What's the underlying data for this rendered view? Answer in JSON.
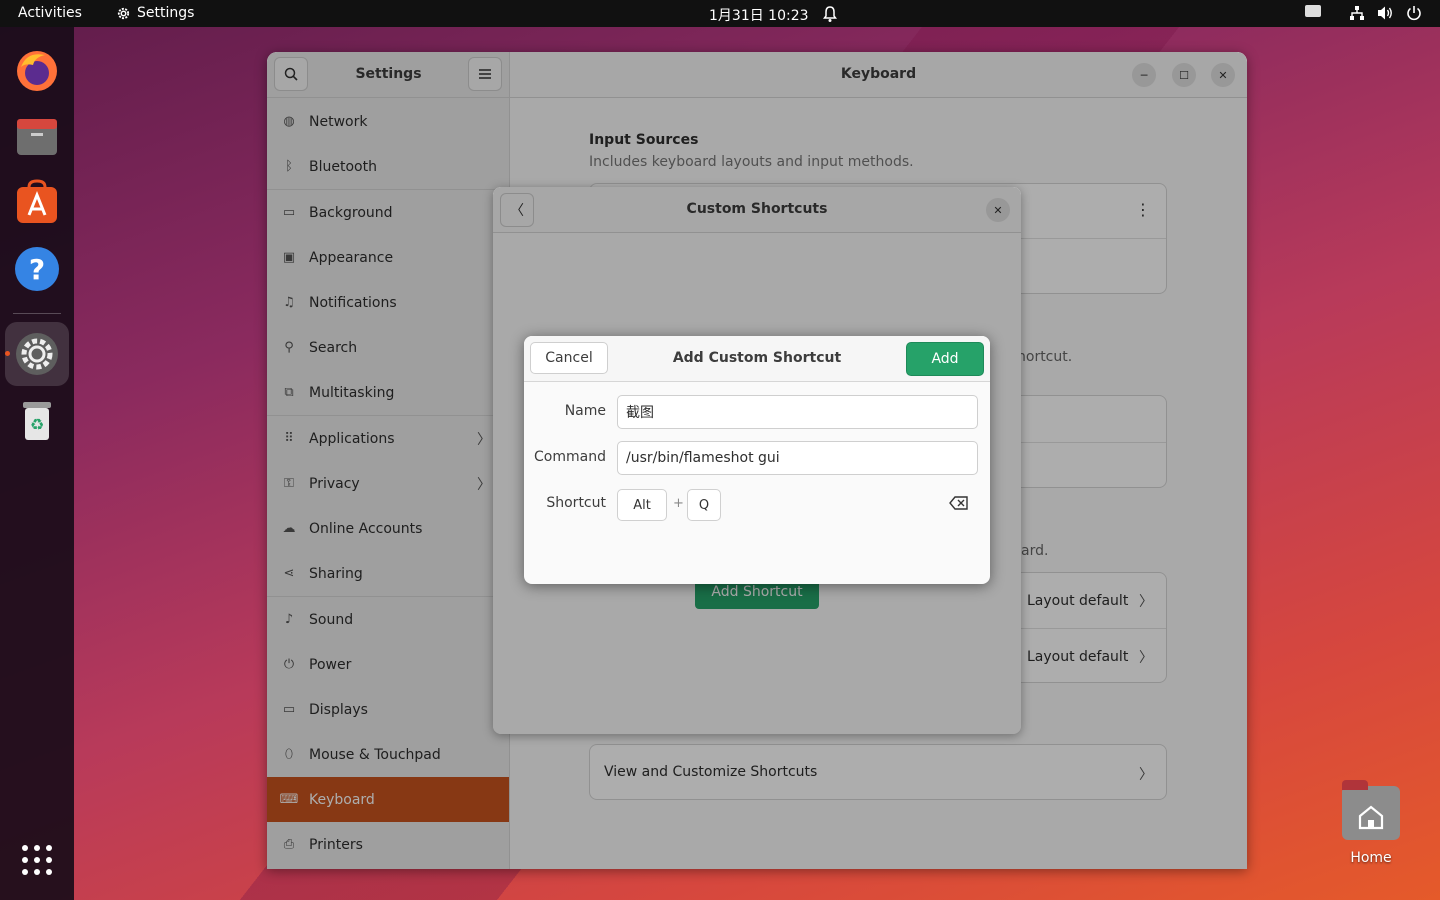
{
  "topbar": {
    "activities": "Activities",
    "app_name": "Settings",
    "clock": "1月31日  10:23"
  },
  "dock": {
    "items": [
      {
        "name": "firefox-icon"
      },
      {
        "name": "files-icon"
      },
      {
        "name": "app-center-icon"
      },
      {
        "name": "help-icon"
      },
      {
        "name": "settings-icon",
        "active": true
      },
      {
        "name": "trash-icon"
      }
    ]
  },
  "desktop": {
    "home_label": "Home"
  },
  "settings": {
    "sidebar_title": "Settings",
    "content_title": "Keyboard",
    "sidebar_items": [
      {
        "label": "Network",
        "icon": "network-icon"
      },
      {
        "label": "Bluetooth",
        "icon": "bluetooth-icon"
      },
      {
        "label": "Background",
        "icon": "background-icon"
      },
      {
        "label": "Appearance",
        "icon": "appearance-icon"
      },
      {
        "label": "Notifications",
        "icon": "bell-icon"
      },
      {
        "label": "Search",
        "icon": "search-icon"
      },
      {
        "label": "Multitasking",
        "icon": "multitasking-icon"
      },
      {
        "label": "Applications",
        "icon": "grid-icon"
      },
      {
        "label": "Privacy",
        "icon": "lock-icon"
      },
      {
        "label": "Online Accounts",
        "icon": "cloud-icon"
      },
      {
        "label": "Sharing",
        "icon": "share-icon"
      },
      {
        "label": "Sound",
        "icon": "music-note-icon"
      },
      {
        "label": "Power",
        "icon": "power-icon"
      },
      {
        "label": "Displays",
        "icon": "display-icon"
      },
      {
        "label": "Mouse & Touchpad",
        "icon": "mouse-icon"
      },
      {
        "label": "Keyboard",
        "icon": "keyboard-icon",
        "selected": true
      },
      {
        "label": "Printers",
        "icon": "printer-icon"
      }
    ],
    "keyboard": {
      "input_sources_title": "Input Sources",
      "input_sources_sub": "Includes keyboard layouts and input methods.",
      "partial_text_1": "hortcut.",
      "partial_text_2": "ard.",
      "layout_default_1": "Layout default",
      "layout_default_2": "Layout default",
      "view_shortcuts": "View and Customize Shortcuts"
    }
  },
  "custom_shortcuts": {
    "title": "Custom Shortcuts",
    "add_shortcut_button": "Add Shortcut"
  },
  "add_custom_shortcut": {
    "title": "Add Custom Shortcut",
    "cancel": "Cancel",
    "add": "Add",
    "name_label": "Name",
    "name_value": "截图",
    "command_label": "Command",
    "command_value": "/usr/bin/flameshot gui",
    "shortcut_label": "Shortcut",
    "key_1": "Alt",
    "plus": "+",
    "key_2": "Q"
  },
  "colors": {
    "accent": "#c7531e",
    "add_green": "#26a269",
    "topbar": "#111111"
  }
}
